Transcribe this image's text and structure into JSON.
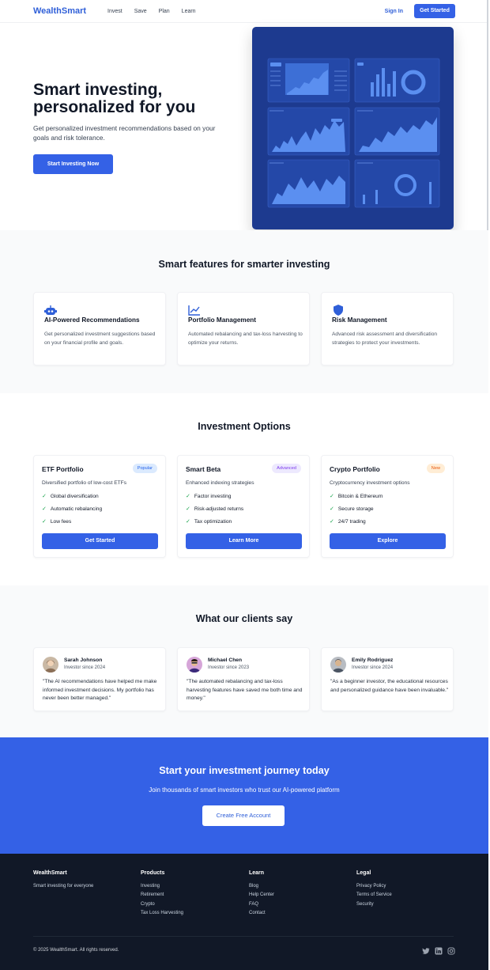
{
  "header": {
    "logo": "WealthSmart",
    "nav": [
      "Invest",
      "Save",
      "Plan",
      "Learn"
    ],
    "signin": "Sign In",
    "cta": "Get Started"
  },
  "hero": {
    "title": "Smart investing, personalized for you",
    "subtitle": "Get personalized investment recommendations based on your goals and risk tolerance.",
    "cta": "Start Investing Now"
  },
  "features": {
    "title": "Smart features for smarter investing",
    "items": [
      {
        "icon": "robot-icon",
        "title": "AI-Powered Recommendations",
        "desc": "Get personalized investment suggestions based on your financial profile and goals."
      },
      {
        "icon": "chart-line-icon",
        "title": "Portfolio Management",
        "desc": "Automated rebalancing and tax-loss harvesting to optimize your returns."
      },
      {
        "icon": "shield-icon",
        "title": "Risk Management",
        "desc": "Advanced risk assessment and diversification strategies to protect your investments."
      }
    ]
  },
  "investment": {
    "title": "Investment Options",
    "cards": [
      {
        "title": "ETF Portfolio",
        "badge": "Popular",
        "badge_bg": "#dbeafe",
        "badge_fg": "#2563eb",
        "subtitle": "Diversified portfolio of low-cost ETFs",
        "features": [
          "Global diversification",
          "Automatic rebalancing",
          "Low fees"
        ],
        "button": "Get Started"
      },
      {
        "title": "Smart Beta",
        "badge": "Advanced",
        "badge_bg": "#ede9fe",
        "badge_fg": "#7c3aed",
        "subtitle": "Enhanced indexing strategies",
        "features": [
          "Factor investing",
          "Risk-adjusted returns",
          "Tax optimization"
        ],
        "button": "Learn More"
      },
      {
        "title": "Crypto Portfolio",
        "badge": "New",
        "badge_bg": "#ffedd5",
        "badge_fg": "#ea580c",
        "subtitle": "Cryptocurrency investment options",
        "features": [
          "Bitcoin & Ethereum",
          "Secure storage",
          "24/7 trading"
        ],
        "button": "Explore"
      }
    ]
  },
  "testimonials": {
    "title": "What our clients say",
    "items": [
      {
        "name": "Sarah Johnson",
        "since": "Investor since 2024",
        "quote": "\"The AI recommendations have helped me make informed investment decisions. My portfolio has never been better managed.\""
      },
      {
        "name": "Michael Chen",
        "since": "Investor since 2023",
        "quote": "\"The automated rebalancing and tax-loss harvesting features have saved me both time and money.\""
      },
      {
        "name": "Emily Rodriguez",
        "since": "Investor since 2024",
        "quote": "\"As a beginner investor, the educational resources and personalized guidance have been invaluable.\""
      }
    ]
  },
  "cta_band": {
    "title": "Start your investment journey today",
    "subtitle": "Join thousands of smart investors who trust our AI-powered platform",
    "button": "Create Free Account"
  },
  "footer": {
    "brand": "WealthSmart",
    "tagline": "Smart investing for everyone",
    "cols": [
      {
        "head": "Products",
        "links": [
          "Investing",
          "Retirement",
          "Crypto",
          "Tax Loss Harvesting"
        ]
      },
      {
        "head": "Learn",
        "links": [
          "Blog",
          "Help Center",
          "FAQ",
          "Contact"
        ]
      },
      {
        "head": "Legal",
        "links": [
          "Privacy Policy",
          "Terms of Service",
          "Security"
        ]
      }
    ],
    "copyright": "© 2025 WealthSmart. All rights reserved.",
    "social": [
      "twitter-icon",
      "linkedin-icon",
      "instagram-icon"
    ]
  },
  "colors": {
    "brand": "#3461e6",
    "dashboard": "#1d3a8f",
    "footer": "#111827"
  }
}
